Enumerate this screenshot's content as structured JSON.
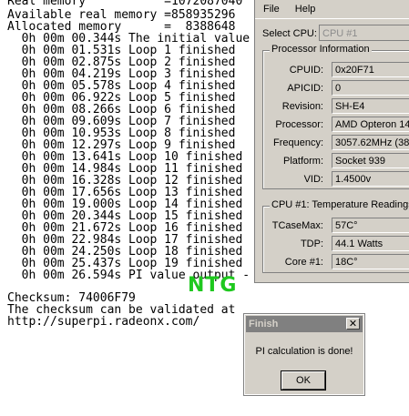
{
  "console": {
    "header": [
      "Real memory           =1072087040",
      "Available real memory =858935296",
      "Allocated memory      =  8388648"
    ],
    "loops": [
      "  0h 00m 00.344s The initial value",
      "  0h 00m 01.531s Loop 1 finished",
      "  0h 00m 02.875s Loop 2 finished",
      "  0h 00m 04.219s Loop 3 finished",
      "  0h 00m 05.578s Loop 4 finished",
      "  0h 00m 06.922s Loop 5 finished",
      "  0h 00m 08.266s Loop 6 finished",
      "  0h 00m 09.609s Loop 7 finished",
      "  0h 00m 10.953s Loop 8 finished",
      "  0h 00m 12.297s Loop 9 finished",
      "  0h 00m 13.641s Loop 10 finished",
      "  0h 00m 14.984s Loop 11 finished",
      "  0h 00m 16.328s Loop 12 finished",
      "  0h 00m 17.656s Loop 13 finished",
      "  0h 00m 19.000s Loop 14 finished",
      "  0h 00m 20.344s Loop 15 finished",
      "  0h 00m 21.672s Loop 16 finished",
      "  0h 00m 22.984s Loop 17 finished",
      "  0h 00m 24.250s Loop 18 finished",
      "  0h 00m 25.437s Loop 19 finished",
      "  0h 00m 26.594s PI value output -"
    ],
    "checksum": "Checksum: 74006F79",
    "validate_1": "The checksum can be validated at",
    "validate_2": "http://superpi.radeonx.com/",
    "watermark": "NTG"
  },
  "cpu_window": {
    "menu": [
      "File",
      "Help"
    ],
    "select_label": "Select CPU:",
    "select_value": "CPU #1",
    "processor_group_title": "Processor Information",
    "processor_rows": [
      {
        "label": "CPUID:",
        "value": "0x20F71"
      },
      {
        "label": "APICID:",
        "value": "0"
      },
      {
        "label": "Revision:",
        "value": "SH-E4"
      },
      {
        "label": "Processor:",
        "value": "AMD Opteron 146 r"
      },
      {
        "label": "Frequency:",
        "value": "3057.62MHz (382.2"
      },
      {
        "label": "Platform:",
        "value": "Socket 939"
      },
      {
        "label": "VID:",
        "value": "1.4500v"
      }
    ],
    "temp_group_title": "CPU #1: Temperature Readings",
    "temp_rows": [
      {
        "label": "TCaseMax:",
        "value": "57C°"
      },
      {
        "label": "TDP:",
        "value": "44.1 Watts"
      },
      {
        "label": "Core #1:",
        "value": "18C°"
      }
    ]
  },
  "dialog": {
    "title": "Finish",
    "message": "PI calculation is done!",
    "ok_label": "OK",
    "close_glyph": "✕"
  }
}
